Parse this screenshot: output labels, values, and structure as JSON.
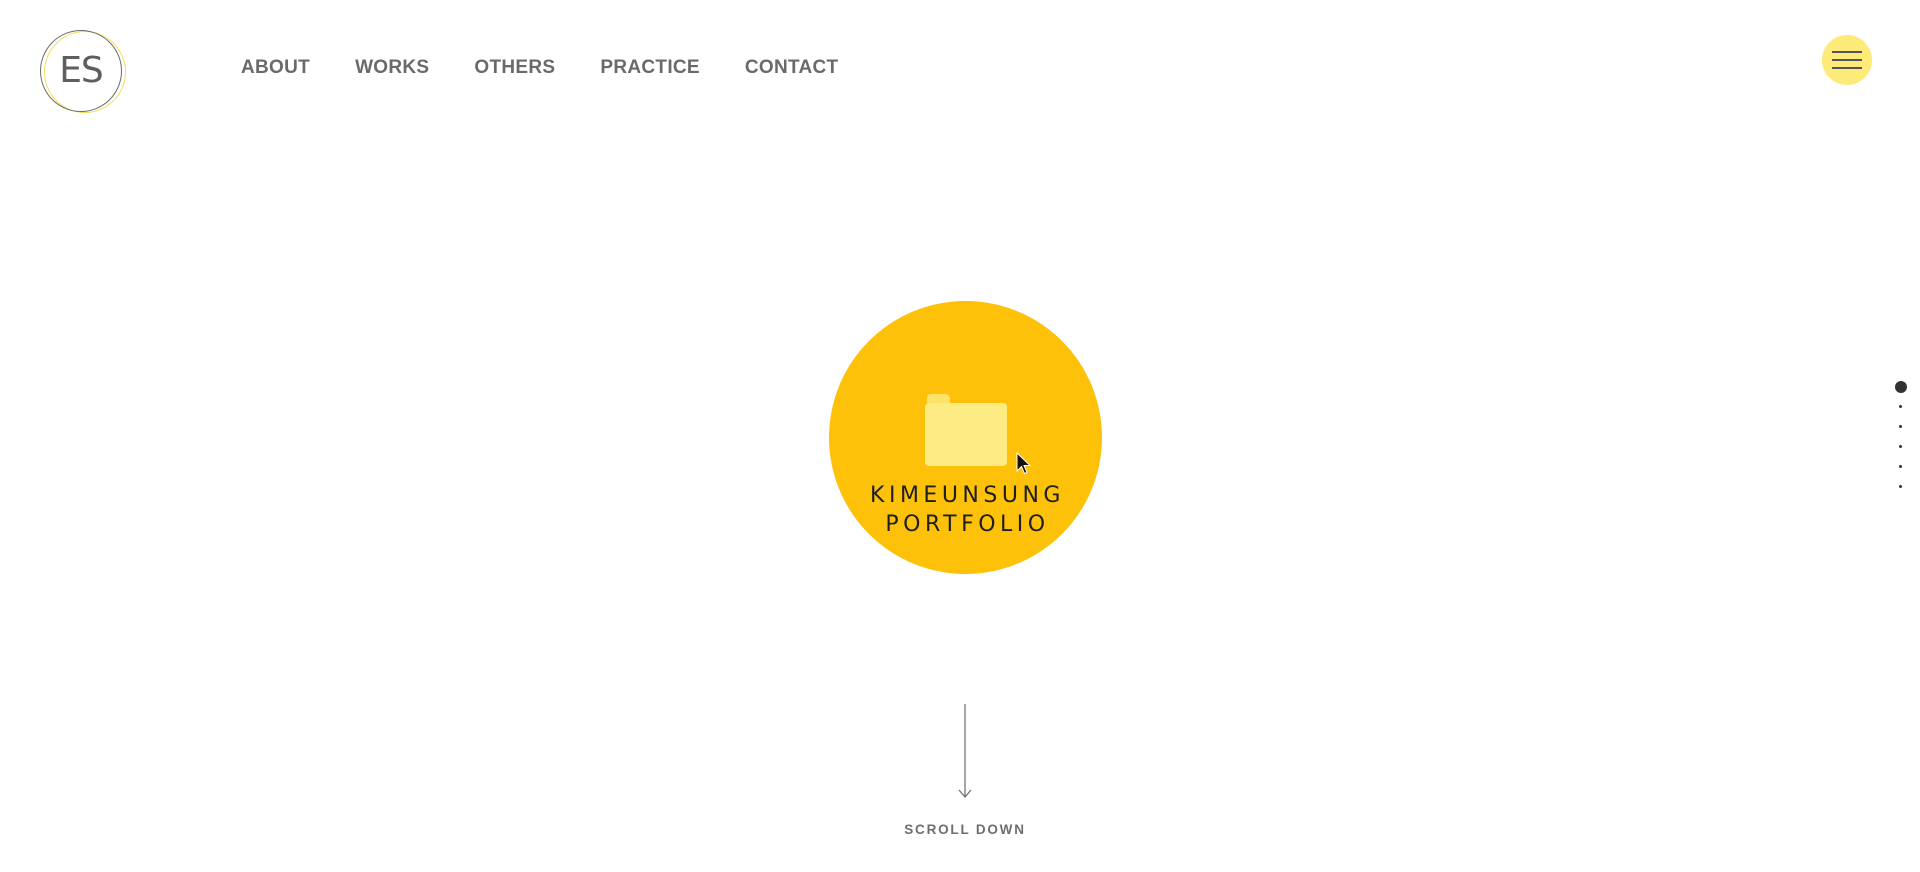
{
  "logo": {
    "text": "ES",
    "icon": "logo-monogram"
  },
  "nav": {
    "items": [
      {
        "label": "ABOUT"
      },
      {
        "label": "WORKS"
      },
      {
        "label": "OTHERS"
      },
      {
        "label": "PRACTICE"
      },
      {
        "label": "CONTACT"
      }
    ]
  },
  "menu": {
    "icon": "hamburger-icon"
  },
  "hero": {
    "icon": "folder-icon",
    "title_line1": "KIMEUNSUNG",
    "title_line2": "PORTFOLIO"
  },
  "scroll": {
    "label": "SCROLL DOWN",
    "icon": "arrow-down-icon"
  },
  "pager": {
    "count": 6,
    "active_index": 0
  },
  "colors": {
    "accent": "#fdc10a",
    "menu_bg": "#fdea78",
    "folder": "#fdeb84",
    "text_gray": "#6a6a6a"
  }
}
